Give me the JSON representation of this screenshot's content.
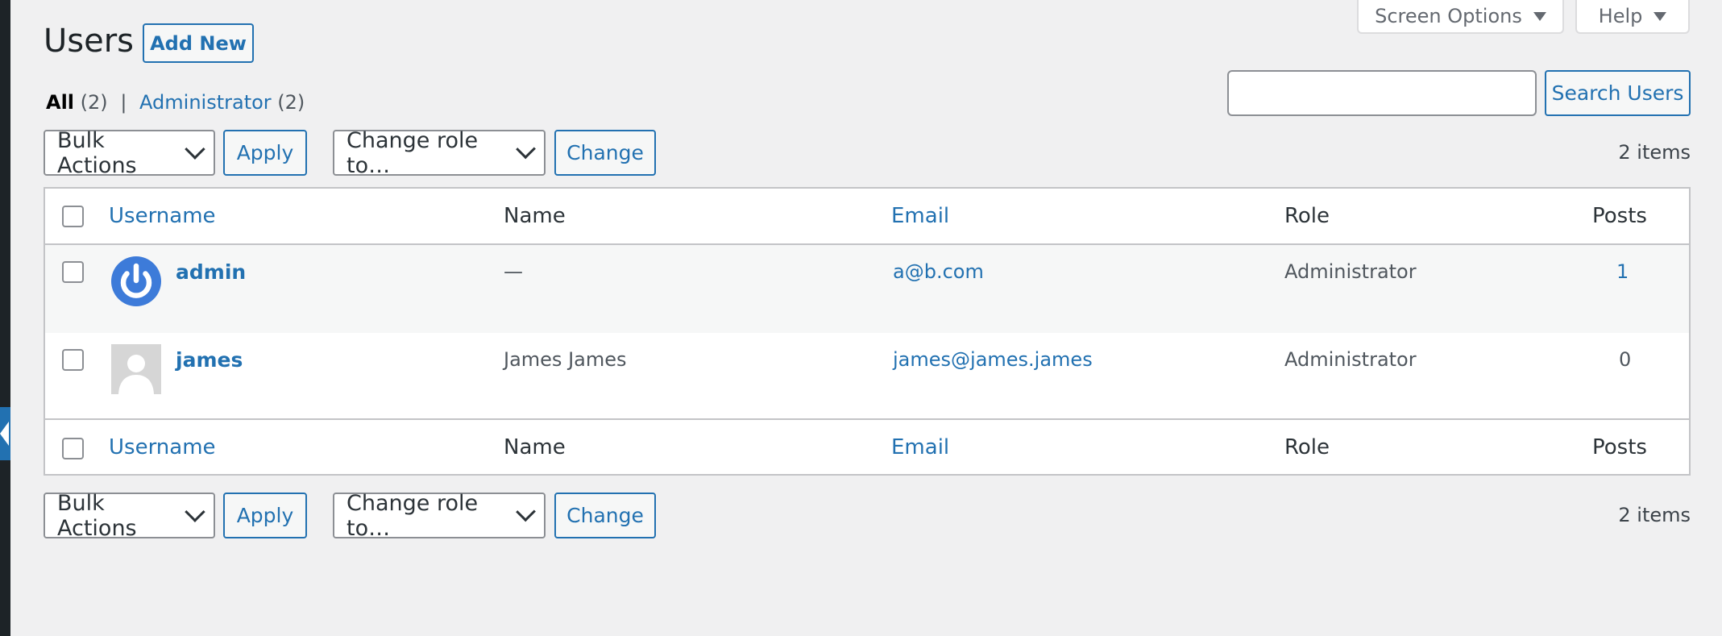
{
  "header": {
    "title": "Users",
    "add_new": "Add New",
    "screen_options": "Screen Options",
    "help": "Help"
  },
  "views": {
    "all_label": "All",
    "all_count": "(2)",
    "separator": "|",
    "admin_label": "Administrator",
    "admin_count": "(2)"
  },
  "search": {
    "value": "",
    "button": "Search Users"
  },
  "tablenav": {
    "bulk_actions": "Bulk Actions",
    "apply": "Apply",
    "change_role": "Change role to…",
    "change": "Change",
    "items_count": "2 items"
  },
  "table": {
    "columns": [
      "Username",
      "Name",
      "Email",
      "Role",
      "Posts"
    ],
    "rows": [
      {
        "username": "admin",
        "name": "—",
        "email": "a@b.com",
        "role": "Administrator",
        "posts": "1",
        "avatar": "power-icon"
      },
      {
        "username": "james",
        "name": "James James",
        "email": "james@james.james",
        "role": "Administrator",
        "posts": "0",
        "avatar": "mystery-person"
      }
    ]
  },
  "colors": {
    "accent": "#2271b1",
    "background": "#f0f0f1",
    "alt_row": "#f6f7f7",
    "admin_bar": "#1d2327"
  }
}
